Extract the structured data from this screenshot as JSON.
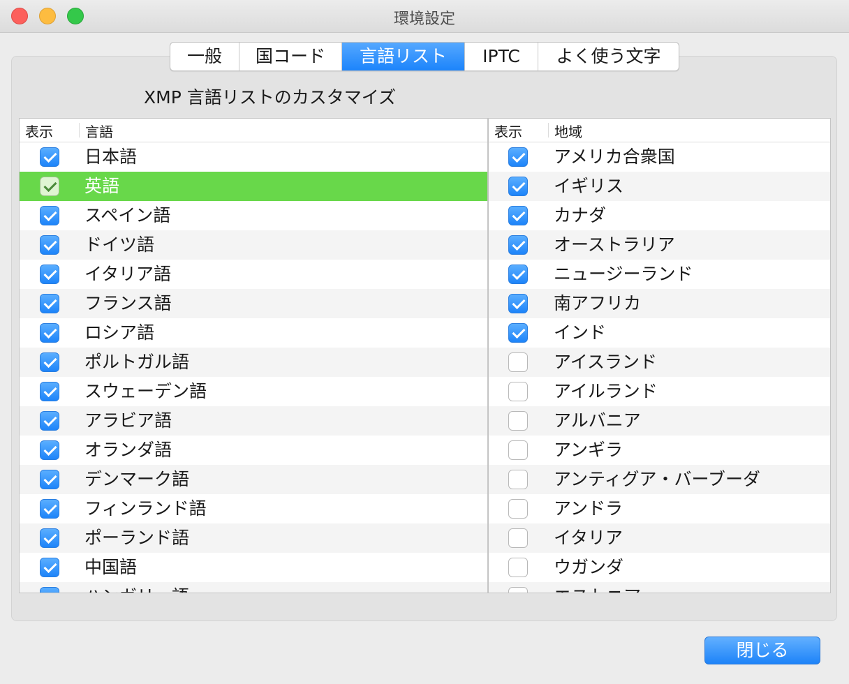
{
  "window": {
    "title": "環境設定"
  },
  "tabs": [
    {
      "label": "一般",
      "active": false
    },
    {
      "label": "国コード",
      "active": false
    },
    {
      "label": "言語リスト",
      "active": true
    },
    {
      "label": "IPTC",
      "active": false
    },
    {
      "label": "よく使う文字",
      "active": false
    }
  ],
  "heading": "XMP 言語リストのカスタマイズ",
  "language_table": {
    "col_show": "表示",
    "col_name": "言語",
    "rows": [
      {
        "name": "日本語",
        "checked": true
      },
      {
        "name": "英語",
        "checked": true,
        "selected": true
      },
      {
        "name": "スペイン語",
        "checked": true
      },
      {
        "name": "ドイツ語",
        "checked": true
      },
      {
        "name": "イタリア語",
        "checked": true
      },
      {
        "name": "フランス語",
        "checked": true
      },
      {
        "name": "ロシア語",
        "checked": true
      },
      {
        "name": "ポルトガル語",
        "checked": true
      },
      {
        "name": "スウェーデン語",
        "checked": true
      },
      {
        "name": "アラビア語",
        "checked": true
      },
      {
        "name": "オランダ語",
        "checked": true
      },
      {
        "name": "デンマーク語",
        "checked": true
      },
      {
        "name": "フィンランド語",
        "checked": true
      },
      {
        "name": "ポーランド語",
        "checked": true
      },
      {
        "name": "中国語",
        "checked": true
      },
      {
        "name": "ハンガリー語",
        "checked": true
      }
    ]
  },
  "region_table": {
    "col_show": "表示",
    "col_name": "地域",
    "rows": [
      {
        "name": "アメリカ合衆国",
        "checked": true
      },
      {
        "name": "イギリス",
        "checked": true
      },
      {
        "name": "カナダ",
        "checked": true
      },
      {
        "name": "オーストラリア",
        "checked": true
      },
      {
        "name": "ニュージーランド",
        "checked": true
      },
      {
        "name": "南アフリカ",
        "checked": true
      },
      {
        "name": "インド",
        "checked": true
      },
      {
        "name": "アイスランド",
        "checked": false
      },
      {
        "name": "アイルランド",
        "checked": false
      },
      {
        "name": "アルバニア",
        "checked": false
      },
      {
        "name": "アンギラ",
        "checked": false
      },
      {
        "name": "アンティグア・バーブーダ",
        "checked": false
      },
      {
        "name": "アンドラ",
        "checked": false
      },
      {
        "name": "イタリア",
        "checked": false
      },
      {
        "name": "ウガンダ",
        "checked": false
      },
      {
        "name": "エストニア",
        "checked": false
      }
    ]
  },
  "close_button": "閉じる"
}
